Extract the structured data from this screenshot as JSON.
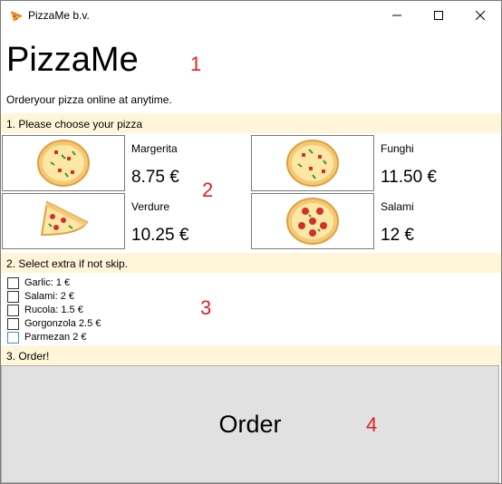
{
  "window": {
    "title": "PizzaMe b.v.",
    "controls": [
      "minimize",
      "maximize",
      "close"
    ]
  },
  "header": {
    "app_name": "PizzaMe",
    "tagline": "Orderyour pizza online at anytime."
  },
  "sections": {
    "choose": "1. Please choose your pizza",
    "extras": "2. Select extra if not skip.",
    "order": "3. Order!"
  },
  "pizzas": [
    {
      "name": "Margerita",
      "price": "8.75 €",
      "icon": "whole-pizza-icon"
    },
    {
      "name": "Funghi",
      "price": "11.50 €",
      "icon": "whole-pizza-icon"
    },
    {
      "name": "Verdure",
      "price": "10.25 €",
      "icon": "pizza-slice-icon"
    },
    {
      "name": "Salami",
      "price": "12 €",
      "icon": "salami-pizza-icon"
    }
  ],
  "extras": [
    {
      "label": "Garlic: 1 €",
      "checked": false
    },
    {
      "label": "Salami: 2 €",
      "checked": false
    },
    {
      "label": "Rucola: 1.5 €",
      "checked": false
    },
    {
      "label": "Gorgonzola 2.5 €",
      "checked": false
    },
    {
      "label": "Parmezan 2 €",
      "checked": false
    }
  ],
  "order_button": {
    "label": "Order"
  },
  "annotations": [
    "1",
    "2",
    "3",
    "4"
  ],
  "colors": {
    "section_background": "#fff6d9",
    "button_background": "#e1e1e1",
    "annotation": "#e0202a"
  }
}
